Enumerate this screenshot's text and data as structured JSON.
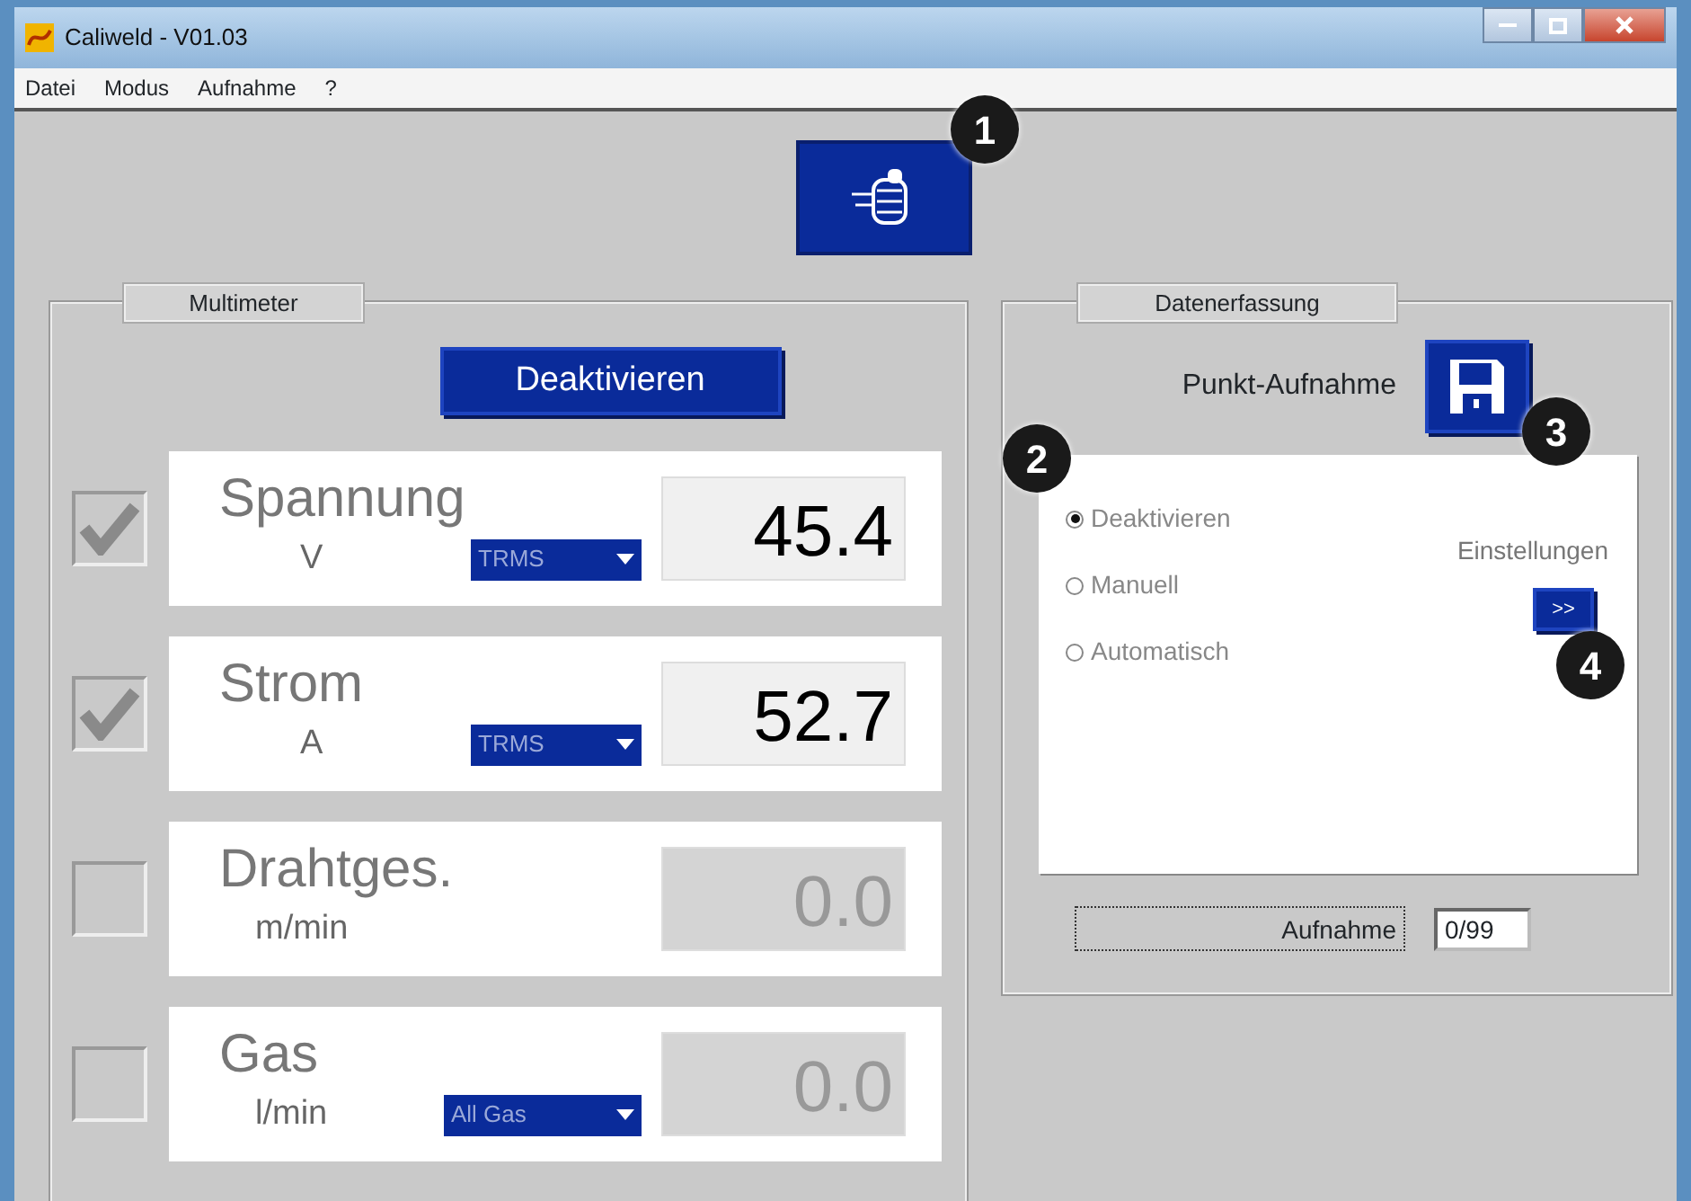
{
  "window": {
    "title": "Caliweld - V01.03"
  },
  "menu": [
    "Datei",
    "Modus",
    "Aufnahme",
    "?"
  ],
  "multimeter": {
    "title": "Multimeter",
    "button": "Deaktivieren",
    "channels": [
      {
        "name": "Spannung",
        "unit": "V",
        "checked": true,
        "mode": "TRMS",
        "value": "45.4"
      },
      {
        "name": "Strom",
        "unit": "A",
        "checked": true,
        "mode": "TRMS",
        "value": "52.7"
      },
      {
        "name": "Drahtges.",
        "unit": "m/min",
        "checked": false,
        "value": "0.0"
      },
      {
        "name": "Gas",
        "unit": "l/min",
        "checked": false,
        "mode": "All Gas",
        "value": "0.0"
      }
    ]
  },
  "datenerfassung": {
    "title": "Datenerfassung",
    "point_label": "Punkt-Aufnahme",
    "modes": [
      {
        "label": "Deaktivieren",
        "selected": true
      },
      {
        "label": "Manuell",
        "selected": false
      },
      {
        "label": "Automatisch",
        "selected": false
      }
    ],
    "settings_label": "Einstellungen",
    "settings_button": ">>",
    "record_label": "Aufnahme",
    "counter": "0/99"
  },
  "callouts": [
    "1",
    "2",
    "3",
    "4"
  ]
}
